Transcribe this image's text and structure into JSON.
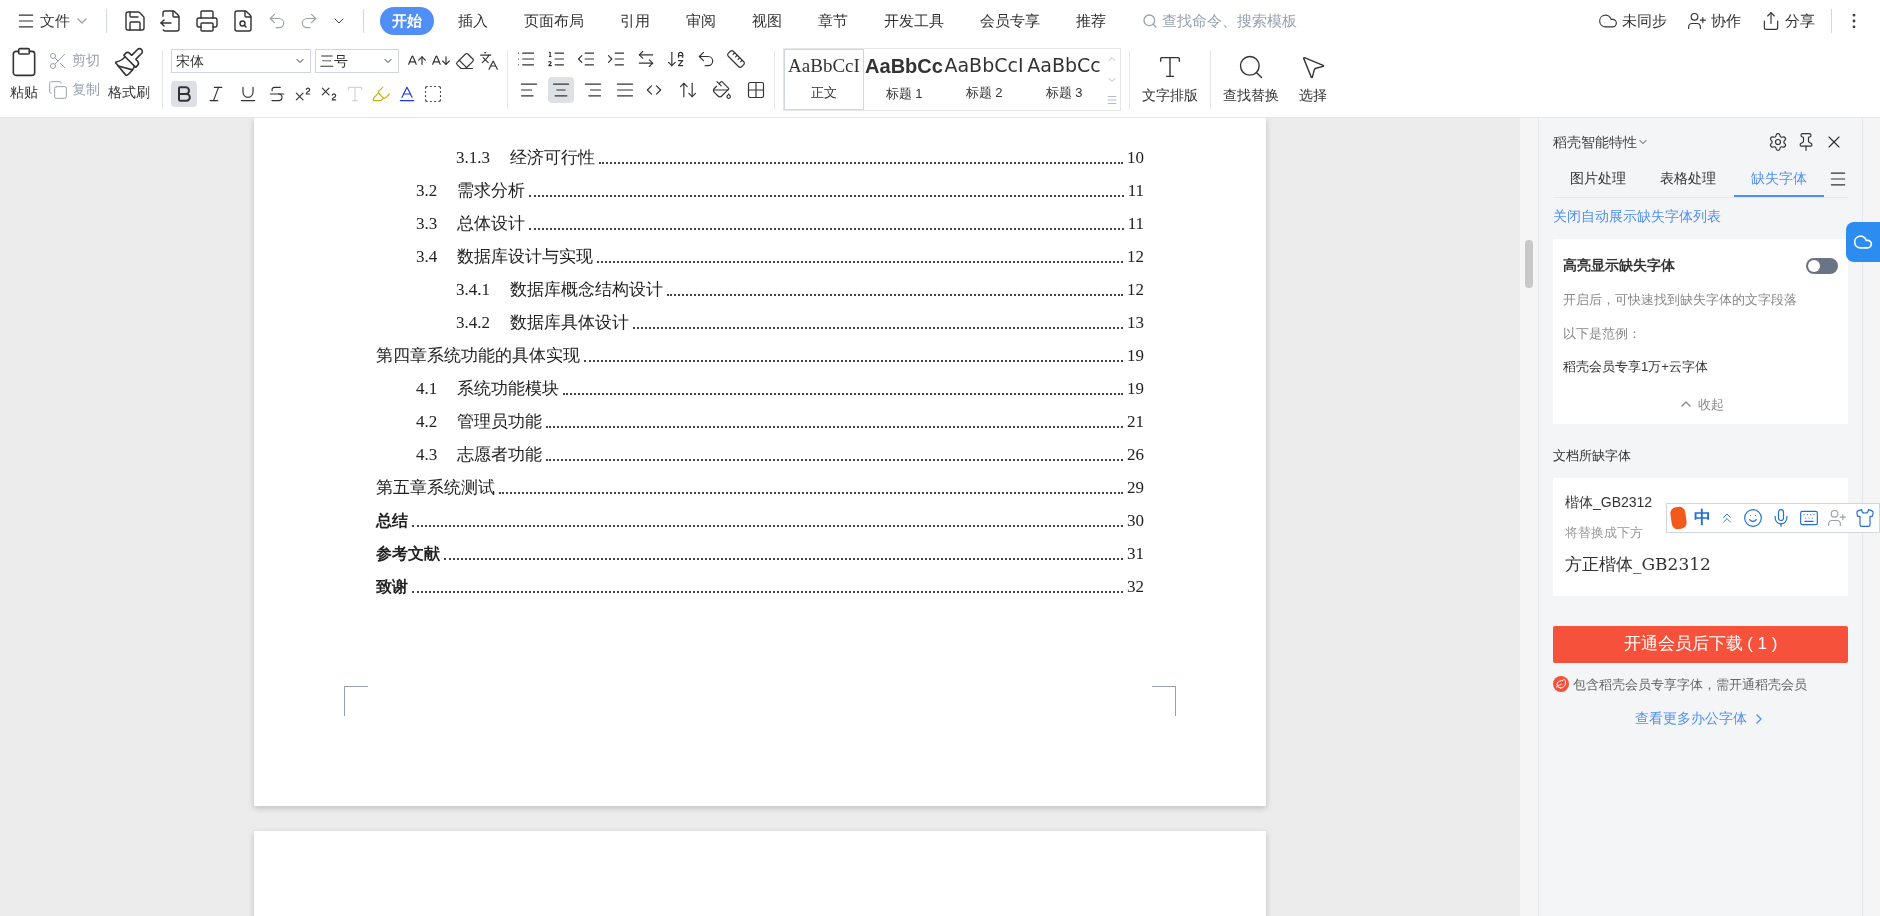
{
  "menu": {
    "file": "文件"
  },
  "tabs": [
    {
      "label": "开始",
      "selected": true
    },
    {
      "label": "插入",
      "selected": false
    },
    {
      "label": "页面布局",
      "selected": false
    },
    {
      "label": "引用",
      "selected": false
    },
    {
      "label": "审阅",
      "selected": false
    },
    {
      "label": "视图",
      "selected": false
    },
    {
      "label": "章节",
      "selected": false
    },
    {
      "label": "开发工具",
      "selected": false
    },
    {
      "label": "会员专享",
      "selected": false
    },
    {
      "label": "推荐",
      "selected": false
    }
  ],
  "search": {
    "placeholder": "查找命令、搜索模板"
  },
  "top_actions": [
    {
      "kind": "sync",
      "label": "未同步"
    },
    {
      "kind": "collab",
      "label": "协作"
    },
    {
      "kind": "share",
      "label": "分享"
    }
  ],
  "ribbon": {
    "paste": "粘贴",
    "cut": "剪切",
    "copy": "复制",
    "format_painter": "格式刷",
    "font": "宋体",
    "size": "三号",
    "format_buttons": [
      {
        "kind": "bold",
        "selected": true
      },
      {
        "kind": "italic",
        "selected": false
      },
      {
        "kind": "underline",
        "selected": false
      }
    ],
    "align_buttons": [
      {
        "kind": "left",
        "selected": false
      },
      {
        "kind": "center",
        "selected": true
      },
      {
        "kind": "right",
        "selected": false
      },
      {
        "kind": "justify",
        "selected": false
      }
    ],
    "styles": [
      {
        "preview": "AaBbCcI",
        "label": "正文"
      },
      {
        "preview": "AaBbCc",
        "label": "标题 1"
      },
      {
        "preview": "AaBbCcI",
        "label": "标题 2"
      },
      {
        "preview": "AaBbCc",
        "label": "标题 3"
      }
    ],
    "layout": "文字排版",
    "find": "查找替换",
    "select": "选择"
  },
  "toc": [
    {
      "children": [
        {
          "children": [
            {
              "number": "3.1.3",
              "title": "经济可行性",
              "page": "10",
              "bold": false
            }
          ]
        },
        {
          "number": "3.2",
          "title": "需求分析",
          "page": "11",
          "bold": false
        },
        {
          "number": "3.3",
          "title": "总体设计",
          "page": "11",
          "bold": false
        },
        {
          "number": "3.4",
          "title": "数据库设计与实现",
          "page": "12",
          "bold": false,
          "children": [
            {
              "number": "3.4.1",
              "title": "数据库概念结构设计",
              "page": "12",
              "bold": false
            },
            {
              "number": "3.4.2",
              "title": "数据库具体设计",
              "page": "13",
              "bold": false
            }
          ]
        }
      ]
    },
    {
      "title": "第四章系统功能的具体实现",
      "page": "19",
      "bold": false,
      "children": [
        {
          "number": "4.1",
          "title": "系统功能模块",
          "page": "19",
          "bold": false
        },
        {
          "number": "4.2",
          "title": "管理员功能",
          "page": "21",
          "bold": false
        },
        {
          "number": "4.3",
          "title": "志愿者功能",
          "page": "26",
          "bold": false
        }
      ]
    },
    {
      "title": "第五章系统测试",
      "page": "29",
      "bold": false
    },
    {
      "title": "总结",
      "page": "30",
      "bold": true
    },
    {
      "title": "参考文献",
      "page": "31",
      "bold": true
    },
    {
      "title": "致谢",
      "page": "32",
      "bold": true
    }
  ],
  "panel": {
    "title": "稻壳智能特性",
    "tabs": [
      {
        "label": "图片处理",
        "selected": false
      },
      {
        "label": "表格处理",
        "selected": false
      },
      {
        "label": "缺失字体",
        "selected": true
      }
    ],
    "close_auto_link": "关闭自动展示缺失字体列表",
    "highlight": {
      "title": "高亮显示缺失字体",
      "on": false,
      "description": "开启后，可快速找到缺失字体的文字段落",
      "example_label": "以下是范例：",
      "example": "稻壳会员专享1万+云字体",
      "collapse": "收起"
    },
    "missing_label": "文档所缺字体",
    "font_card": {
      "name": "楷体_GB2312",
      "replace_hint": "将替换成下方",
      "replacement": "方正楷体_GB2312"
    },
    "download_button": "开通会员后下载 ( 1 )",
    "note": "包含稻壳会员专享字体，需开通稻壳会员",
    "more_link": "查看更多办公字体"
  },
  "ime": {
    "mode": "中"
  }
}
